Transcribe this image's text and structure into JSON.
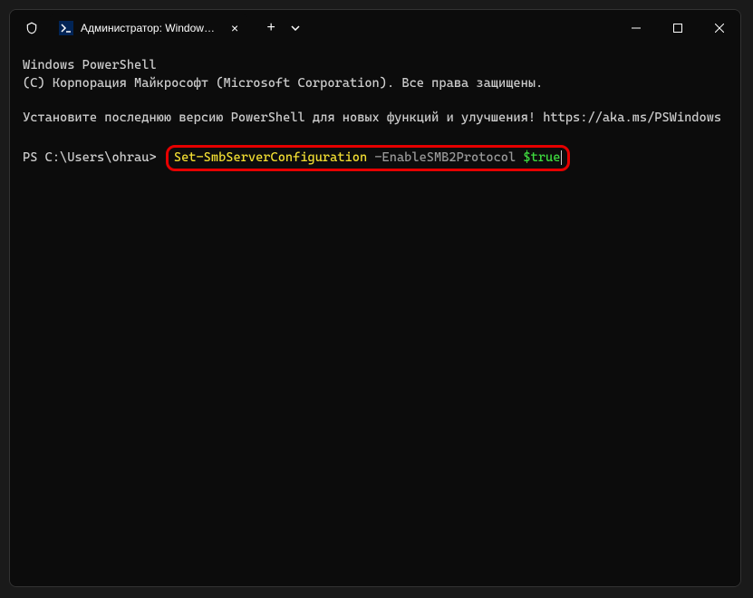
{
  "titlebar": {
    "tab_title": "Администратор: Windows Po"
  },
  "terminal": {
    "line1": "Windows PowerShell",
    "line2": "(C) Корпорация Майкрософт (Microsoft Corporation). Все права защищены.",
    "line3": "Установите последнюю версию PowerShell для новых функций и улучшения! https://aka.ms/PSWindows",
    "prompt": "PS C:\\Users\\ohrau> ",
    "command": {
      "cmdlet": "Set-SmbServerConfiguration",
      "param": " -EnableSMB2Protocol ",
      "value": "$true"
    }
  },
  "colors": {
    "highlight_border": "#e60000",
    "cmd_yellow": "#f2de32",
    "cmd_gray": "#999999",
    "cmd_green": "#3fdb3f"
  }
}
